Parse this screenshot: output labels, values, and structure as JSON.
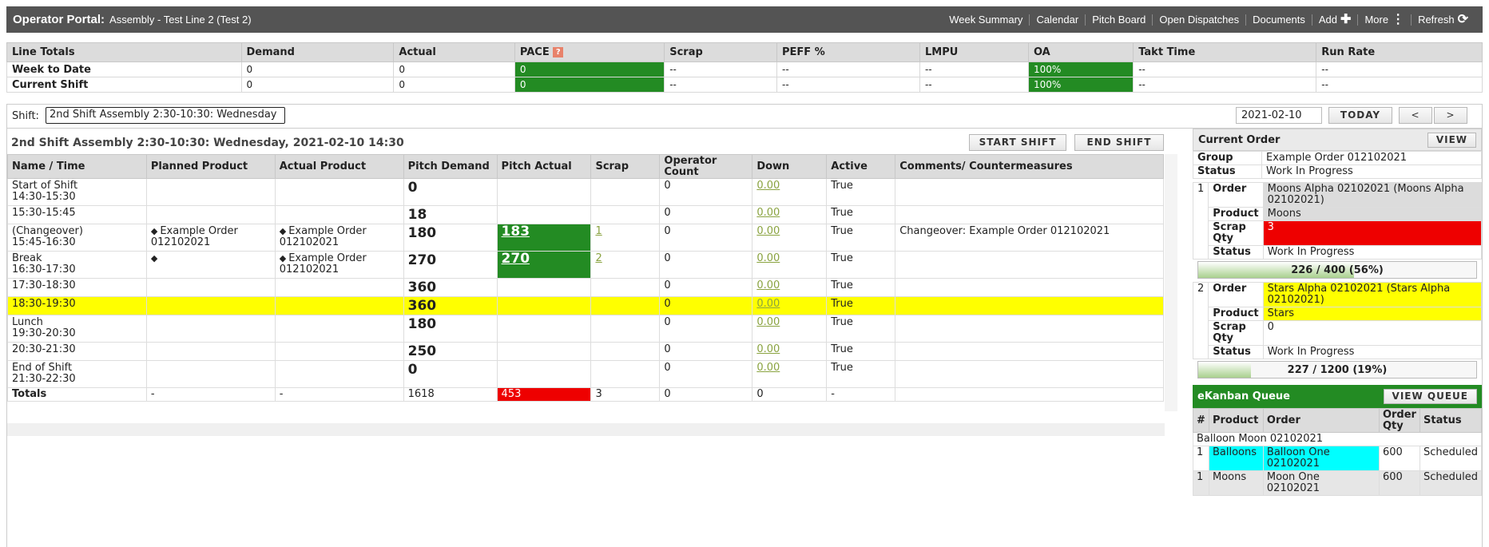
{
  "header": {
    "title": "Operator Portal:",
    "subtitle": "Assembly - Test Line 2 (Test 2)",
    "nav": [
      "Week Summary",
      "Calendar",
      "Pitch Board",
      "Open Dispatches",
      "Documents"
    ],
    "add_label": "Add",
    "more_label": "More",
    "refresh_label": "Refresh"
  },
  "totals": {
    "columns": [
      "Line Totals",
      "Demand",
      "Actual",
      "PACE",
      "Scrap",
      "PEFF %",
      "LMPU",
      "OA",
      "Takt Time",
      "Run Rate"
    ],
    "help_icon": "?",
    "rows": [
      {
        "label": "Week to Date",
        "demand": "0",
        "actual": "0",
        "pace": "0",
        "scrap": "--",
        "peff": "--",
        "lmpu": "--",
        "oa": "100%",
        "takt": "--",
        "run": "--"
      },
      {
        "label": "Current Shift",
        "demand": "0",
        "actual": "0",
        "pace": "0",
        "scrap": "--",
        "peff": "--",
        "lmpu": "--",
        "oa": "100%",
        "takt": "--",
        "run": "--"
      }
    ]
  },
  "shift": {
    "label": "Shift:",
    "selected": "2nd Shift Assembly 2:30-10:30: Wednesday",
    "date": "2021-02-10",
    "today_label": "TODAY",
    "prev_label": "<",
    "next_label": ">",
    "title": "2nd Shift Assembly 2:30-10:30: Wednesday, 2021-02-10 14:30",
    "start_label": "START SHIFT",
    "end_label": "END SHIFT"
  },
  "grid": {
    "columns": [
      "Name / Time",
      "Planned Product",
      "Actual Product",
      "Pitch Demand",
      "Pitch Actual",
      "Scrap",
      "Operator Count",
      "Down",
      "Active",
      "Comments/ Countermeasures"
    ],
    "rows": [
      {
        "name": "Start of Shift",
        "time": "14:30-15:30",
        "planned": "",
        "actual_product": "",
        "demand": "0",
        "pitch_actual": "",
        "scrap": "",
        "operators": "0",
        "down": "0.00",
        "active": "True",
        "comments": "",
        "hl": false
      },
      {
        "name": "",
        "time": "15:30-15:45",
        "planned": "",
        "actual_product": "",
        "demand": "18",
        "pitch_actual": "",
        "scrap": "",
        "operators": "0",
        "down": "0.00",
        "active": "True",
        "comments": "",
        "hl": false
      },
      {
        "name": "(Changeover)",
        "time": "15:45-16:30",
        "planned": "Example Order 012102021",
        "actual_product": "Example Order 012102021",
        "demand": "180",
        "pitch_actual": "183",
        "scrap": "1",
        "operators": "0",
        "down": "0.00",
        "active": "True",
        "comments": "Changeover: Example Order 012102021",
        "hl": false
      },
      {
        "name": "Break",
        "time": "16:30-17:30",
        "planned": "",
        "actual_product": "Example Order 012102021",
        "demand": "270",
        "pitch_actual": "270",
        "scrap": "2",
        "operators": "0",
        "down": "0.00",
        "active": "True",
        "comments": "",
        "hl": false
      },
      {
        "name": "",
        "time": "17:30-18:30",
        "planned": "",
        "actual_product": "",
        "demand": "360",
        "pitch_actual": "",
        "scrap": "",
        "operators": "0",
        "down": "0.00",
        "active": "True",
        "comments": "",
        "hl": false
      },
      {
        "name": "",
        "time": "18:30-19:30",
        "planned": "",
        "actual_product": "",
        "demand": "360",
        "pitch_actual": "",
        "scrap": "",
        "operators": "0",
        "down": "0.00",
        "active": "True",
        "comments": "",
        "hl": true
      },
      {
        "name": "Lunch",
        "time": "19:30-20:30",
        "planned": "",
        "actual_product": "",
        "demand": "180",
        "pitch_actual": "",
        "scrap": "",
        "operators": "0",
        "down": "0.00",
        "active": "True",
        "comments": "",
        "hl": false
      },
      {
        "name": "",
        "time": "20:30-21:30",
        "planned": "",
        "actual_product": "",
        "demand": "250",
        "pitch_actual": "",
        "scrap": "",
        "operators": "0",
        "down": "0.00",
        "active": "True",
        "comments": "",
        "hl": false
      },
      {
        "name": "End of Shift",
        "time": "21:30-22:30",
        "planned": "",
        "actual_product": "",
        "demand": "0",
        "pitch_actual": "",
        "scrap": "",
        "operators": "0",
        "down": "0.00",
        "active": "True",
        "comments": "",
        "hl": false
      }
    ],
    "totals": {
      "label": "Totals",
      "planned": "-",
      "actual_product": "-",
      "demand": "1618",
      "pitch_actual": "453",
      "scrap": "3",
      "operators": "0",
      "down": "0",
      "active": "-",
      "comments": ""
    }
  },
  "current_order": {
    "title": "Current Order",
    "view_label": "VIEW",
    "group_label": "Group",
    "group": "Example Order 012102021",
    "status_label": "Status",
    "status": "Work In Progress",
    "labels": {
      "order": "Order",
      "product": "Product",
      "scrap": "Scrap Qty",
      "status": "Status"
    },
    "orders": [
      {
        "num": "1",
        "order": "Moons Alpha 02102021 (Moons Alpha 02102021)",
        "product": "Moons",
        "scrap_qty": "3",
        "status": "Work In Progress",
        "progress_text": "226 / 400 (56%)",
        "progress": 0.56
      },
      {
        "num": "2",
        "order": "Stars Alpha 02102021 (Stars Alpha 02102021)",
        "product": "Stars",
        "scrap_qty": "0",
        "status": "Work In Progress",
        "progress_text": "227 / 1200 (19%)",
        "progress": 0.19
      }
    ]
  },
  "kanban": {
    "title": "eKanban Queue",
    "view_label": "VIEW QUEUE",
    "columns": [
      "#",
      "Product",
      "Order",
      "Order Qty",
      "Status"
    ],
    "group": "Balloon Moon 02102021",
    "rows": [
      {
        "num": "1",
        "product": "Balloons",
        "order": "Balloon One 02102021",
        "qty": "600",
        "status": "Scheduled"
      },
      {
        "num": "1",
        "product": "Moons",
        "order": "Moon One 02102021",
        "qty": "600",
        "status": "Scheduled"
      }
    ]
  },
  "colors": {
    "header_bg": "#545454",
    "green": "#238b23",
    "red": "#ee0000",
    "yellow": "#ffff00",
    "cyan": "#00ffff"
  },
  "icons": [
    "plus-icon",
    "more-vertical-icon",
    "refresh-icon",
    "help-icon",
    "layers-icon"
  ]
}
